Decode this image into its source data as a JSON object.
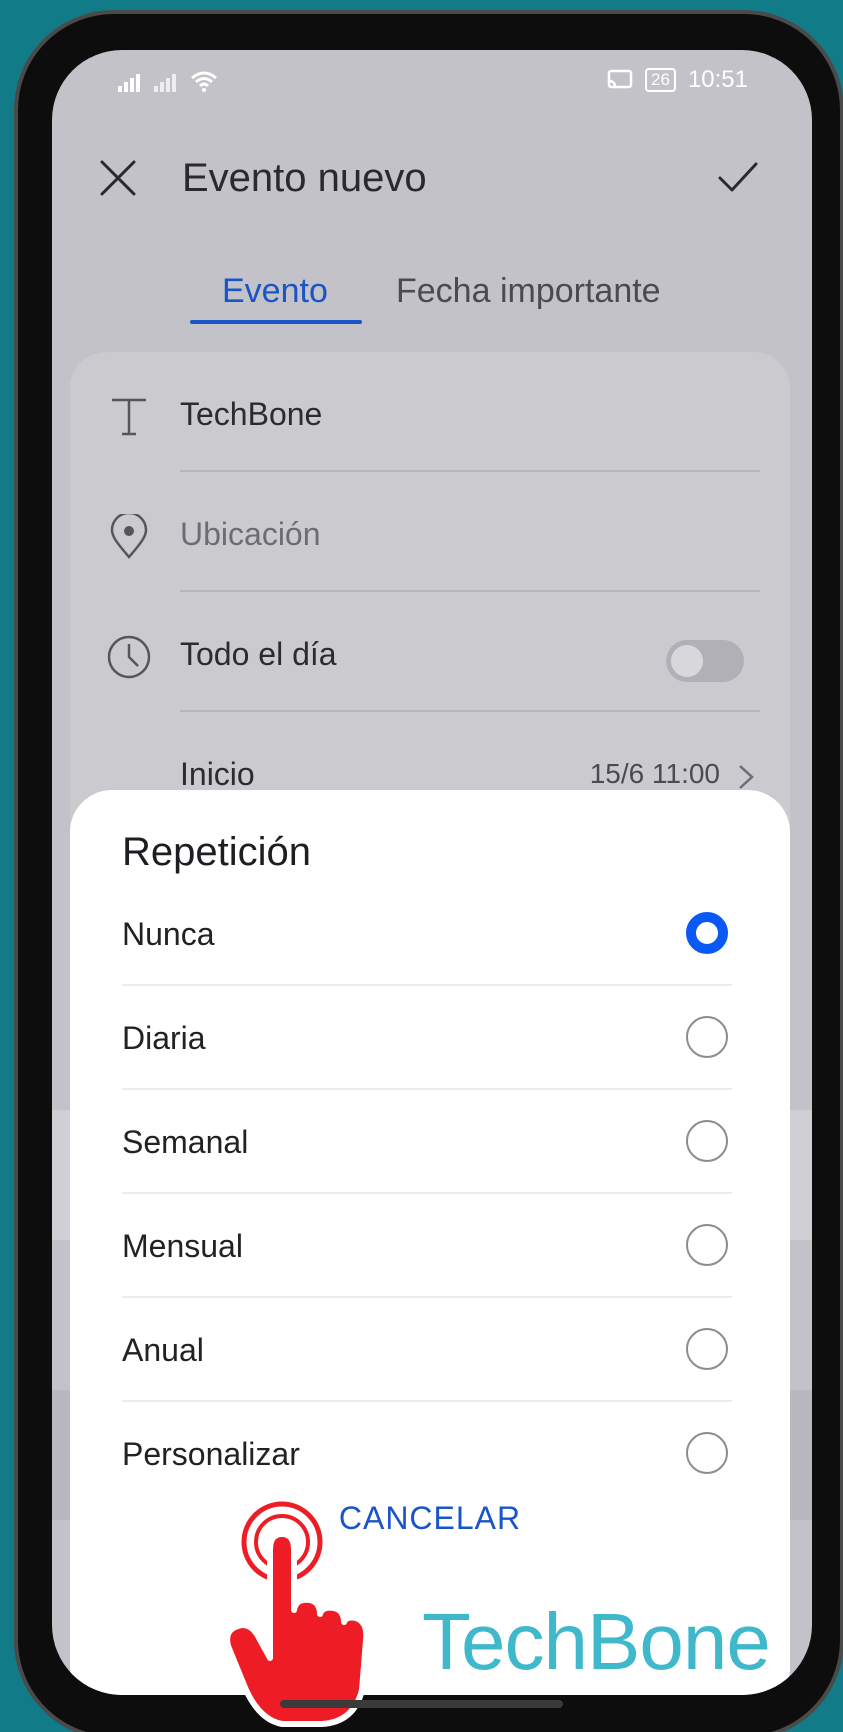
{
  "status_bar": {
    "time": "10:51",
    "battery": "26"
  },
  "header": {
    "title": "Evento nuevo"
  },
  "tabs": [
    {
      "label": "Evento"
    },
    {
      "label": "Fecha importante"
    }
  ],
  "form": {
    "title_value": "TechBone",
    "location_placeholder": "Ubicación",
    "all_day_label": "Todo el día",
    "start_label": "Inicio",
    "start_value": "15/6 11:00"
  },
  "dialog": {
    "title": "Repetición",
    "options": [
      {
        "label": "Nunca",
        "selected": true
      },
      {
        "label": "Diaria",
        "selected": false
      },
      {
        "label": "Semanal",
        "selected": false
      },
      {
        "label": "Mensual",
        "selected": false
      },
      {
        "label": "Anual",
        "selected": false
      },
      {
        "label": "Personalizar",
        "selected": false
      }
    ],
    "cancel_label": "CANCELAR"
  },
  "watermark": "TechBone",
  "colors": {
    "accent": "#1a55c7",
    "radio_selected": "#0a59f5",
    "background": "#117b87",
    "watermark": "#2fb3c7",
    "hand": "#ee1c24"
  }
}
